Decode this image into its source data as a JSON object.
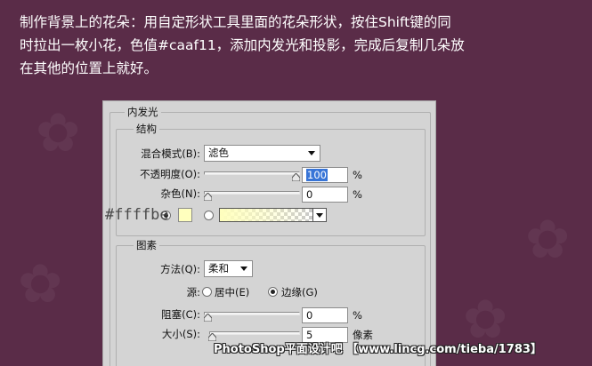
{
  "instruction": {
    "line1": "制作背景上的花朵：用自定形状工具里面的花朵形状，按住Shift键的同",
    "line2": "时拉出一枚小花，色值#caaf11，添加内发光和投影，完成后复制几朵放",
    "line3": "在其他的位置上就好。"
  },
  "dialog": {
    "title": "内发光",
    "structure": {
      "legend": "结构",
      "blend_mode_label": "混合模式(B):",
      "blend_mode_value": "滤色",
      "opacity_label": "不透明度(O):",
      "opacity_value": "100",
      "opacity_percent": 100,
      "opacity_unit": "%",
      "noise_label": "杂色(N):",
      "noise_value": "0",
      "noise_percent": 0,
      "noise_unit": "%",
      "color_annotation": "#ffffbe"
    },
    "elements": {
      "legend": "图素",
      "technique_label": "方法(Q):",
      "technique_value": "柔和",
      "source_label": "源:",
      "source_center": "居中(E)",
      "source_edge": "边缘(G)",
      "choke_label": "阻塞(C):",
      "choke_value": "0",
      "choke_percent": 0,
      "choke_unit": "%",
      "size_label": "大小(S):",
      "size_value": "5",
      "size_unit": "像素"
    }
  },
  "colors": {
    "glow": "#ffffbe",
    "background": "#5a2c48"
  },
  "watermark": "PhotoShop平面设计吧 【www.lincg.com/tieba/1783】"
}
